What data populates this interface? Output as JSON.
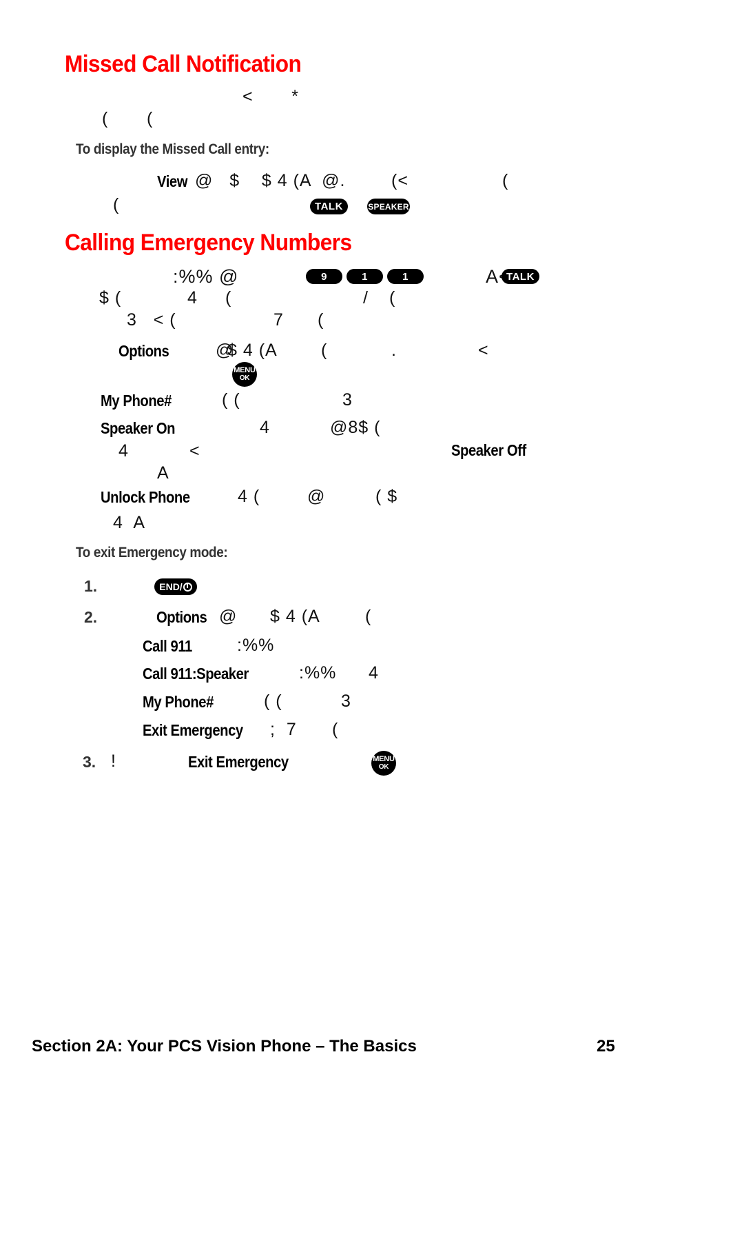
{
  "document": {
    "page_number": "25",
    "footer_label": "Section 2A: Your PCS Vision Phone – The Basics",
    "accent_color": "#ff0000",
    "text_color": "#000000"
  },
  "sections": {
    "missed_call": {
      "heading": "Missed Call Notification",
      "intro_line_1": "<       *",
      "intro_line_2": "(       (",
      "subhead": "To display the Missed Call entry:",
      "step_term": "View",
      "step_line_1": "@   $    $ 4 (A  @.",
      "step_line_1b": "(<",
      "step_line_1c": "(",
      "step_line_2": "("
    },
    "emergency": {
      "heading": "Calling Emergency Numbers",
      "line_1_glyphs": ":%% @",
      "line_1_tail": "A<",
      "line_2_a": "$ (",
      "line_2_b": "4",
      "line_2_c": "(",
      "line_2_d": "/",
      "line_2_e": "(",
      "line_3_a": "3   < (",
      "line_3_b": "7",
      "line_3_c": "(",
      "options_term": "Options",
      "options_glyphs_a": "@",
      "options_glyphs_b": "$ 4 (A",
      "options_glyphs_c": "(",
      "options_glyphs_d": ".",
      "options_glyphs_e": "<",
      "myphone_term": "My Phone#",
      "myphone_glyphs_a": "( (",
      "myphone_glyphs_b": "3",
      "speakeron_term": "Speaker On",
      "speakeron_glyphs_a": "4",
      "speakeron_glyphs_b": "@8$ (",
      "speakeron_line2_a": "4",
      "speakeron_line2_b": "<",
      "speakeroff_term": "Speaker Off",
      "speakeron_line3": "A",
      "unlock_term": "Unlock Phone",
      "unlock_glyphs_a": "4 (",
      "unlock_glyphs_b": "@",
      "unlock_glyphs_c": "( $",
      "unlock_line2": "4  A"
    },
    "exit_emergency": {
      "subhead": "To exit Emergency mode:",
      "step1_num": "1.",
      "step2_num": "2.",
      "step3_num": "3.",
      "step2_term": "Options",
      "step2_glyphs_a": "@",
      "step2_glyphs_b": "$ 4 (A",
      "step2_glyphs_c": "(",
      "item_call911_term": "Call 911",
      "item_call911_glyphs": ":%%",
      "item_call911spk_term": "Call 911:Speaker",
      "item_call911spk_glyphs_a": ":%%",
      "item_call911spk_glyphs_b": "4",
      "item_myphone_term": "My Phone#",
      "item_myphone_glyphs_a": "( (",
      "item_myphone_glyphs_b": "3",
      "item_exit_term": "Exit Emergency",
      "item_exit_glyphs_a": ";  7",
      "item_exit_glyphs_b": "(",
      "step3_glyph": "!",
      "step3_term": "Exit Emergency"
    }
  },
  "key_badges": {
    "talk": "TALK",
    "speaker": "SPEAKER",
    "digit_9": "9",
    "digit_1a": "1",
    "digit_1b": "1",
    "menu_line1": "MENU",
    "menu_line2": "OK",
    "end_label": "END/"
  }
}
